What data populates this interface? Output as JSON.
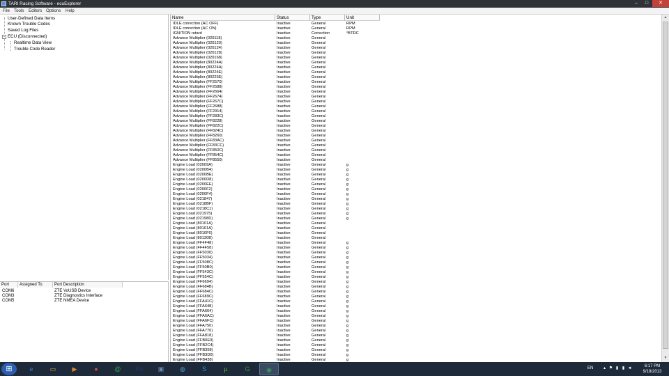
{
  "window": {
    "title": "TARI Racing Software - ecuExplorer",
    "min_glyph": "–",
    "max_glyph": "□",
    "close_glyph": "✕"
  },
  "menu": [
    "File",
    "Tools",
    "Editors",
    "Options",
    "Help"
  ],
  "tree": {
    "items": [
      "User-Defined Data Items",
      "Known Trouble Codes",
      "Saved Log Files",
      "ECU (Disconnected)",
      "Realtime Data View",
      "Trouble Code Reader"
    ],
    "expander": "−"
  },
  "ports": {
    "columns": [
      "Port",
      "Assigned To",
      "Port Description"
    ],
    "rows": [
      [
        "COM6",
        "",
        "ZTE VoUSB Device"
      ],
      [
        "COM3",
        "",
        "ZTE Diagnostics Interface"
      ],
      [
        "COM5",
        "",
        "ZTE NMEA Device"
      ]
    ]
  },
  "grid": {
    "columns": [
      "Name",
      "Status",
      "Type",
      "Unit"
    ],
    "rows": [
      [
        "IDLE correction (AC OFF)",
        "Inactive",
        "General",
        "RPM"
      ],
      [
        "IDLE correction (AC ON)",
        "Inactive",
        "General",
        "RPM"
      ],
      [
        "IGNITION retard",
        "Inactive",
        "Correction",
        "°BTDC"
      ],
      [
        "Advance Multiplier (020118)",
        "Inactive",
        "General",
        ""
      ],
      [
        "Advance Multiplier (020120)",
        "Inactive",
        "General",
        ""
      ],
      [
        "Advance Multiplier (020124)",
        "Inactive",
        "General",
        ""
      ],
      [
        "Advance Multiplier (020128)",
        "Inactive",
        "General",
        ""
      ],
      [
        "Advance Multiplier (020168)",
        "Inactive",
        "General",
        ""
      ],
      [
        "Advance Multiplier (80224A)",
        "Inactive",
        "General",
        ""
      ],
      [
        "Advance Multiplier (80224A)",
        "Inactive",
        "General",
        ""
      ],
      [
        "Advance Multiplier (80224E)",
        "Inactive",
        "General",
        ""
      ],
      [
        "Advance Multiplier (80225E)",
        "Inactive",
        "General",
        ""
      ],
      [
        "Advance Multiplier (FF2570)",
        "Inactive",
        "General",
        ""
      ],
      [
        "Advance Multiplier (FF2588)",
        "Inactive",
        "General",
        ""
      ],
      [
        "Advance Multiplier (FF2664)",
        "Inactive",
        "General",
        ""
      ],
      [
        "Advance Multiplier (FF2674)",
        "Inactive",
        "General",
        ""
      ],
      [
        "Advance Multiplier (FF267C)",
        "Inactive",
        "General",
        ""
      ],
      [
        "Advance Multiplier (FF2688)",
        "Inactive",
        "General",
        ""
      ],
      [
        "Advance Multiplier (FF2914)",
        "Inactive",
        "General",
        ""
      ],
      [
        "Advance Multiplier (FF283C)",
        "Inactive",
        "General",
        ""
      ],
      [
        "Advance Multiplier (FF8228)",
        "Inactive",
        "General",
        ""
      ],
      [
        "Advance Multiplier (FF822C)",
        "Inactive",
        "General",
        ""
      ],
      [
        "Advance Multiplier (FF824C)",
        "Inactive",
        "General",
        ""
      ],
      [
        "Advance Multiplier (FF8260)",
        "Inactive",
        "General",
        ""
      ],
      [
        "Advance Multiplier (FF83AC)",
        "Inactive",
        "General",
        ""
      ],
      [
        "Advance Multiplier (FF83CC)",
        "Inactive",
        "General",
        ""
      ],
      [
        "Advance Multiplier (FF850C)",
        "Inactive",
        "General",
        ""
      ],
      [
        "Advance Multiplier (FF854C)",
        "Inactive",
        "General",
        ""
      ],
      [
        "Advance Multiplier (FF8550)",
        "Inactive",
        "General",
        ""
      ],
      [
        "Engine Load (02009A)",
        "Inactive",
        "General",
        "g"
      ],
      [
        "Engine Load (0200B4)",
        "Inactive",
        "General",
        "g"
      ],
      [
        "Engine Load (0200BE)",
        "Inactive",
        "General",
        "g"
      ],
      [
        "Engine Load (0200D8)",
        "Inactive",
        "General",
        "g"
      ],
      [
        "Engine Load (0200EE)",
        "Inactive",
        "General",
        "g"
      ],
      [
        "Engine Load (0200F2)",
        "Inactive",
        "General",
        "g"
      ],
      [
        "Engine Load (0200F4)",
        "Inactive",
        "General",
        "g"
      ],
      [
        "Engine Load (021847)",
        "Inactive",
        "General",
        "g"
      ],
      [
        "Engine Load (0218BF)",
        "Inactive",
        "General",
        "g"
      ],
      [
        "Engine Load (0218C1)",
        "Inactive",
        "General",
        "g"
      ],
      [
        "Engine Load (021975)",
        "Inactive",
        "General",
        "g"
      ],
      [
        "Engine Load (02198D)",
        "Inactive",
        "General",
        "g"
      ],
      [
        "Engine Load (80101A)",
        "Inactive",
        "General",
        ""
      ],
      [
        "Engine Load (80101A)",
        "Inactive",
        "General",
        ""
      ],
      [
        "Engine Load (8010F6)",
        "Inactive",
        "General",
        ""
      ],
      [
        "Engine Load (80130B)",
        "Inactive",
        "General",
        ""
      ],
      [
        "Engine Load (FF4F48)",
        "Inactive",
        "General",
        "g"
      ],
      [
        "Engine Load (FF4F58)",
        "Inactive",
        "General",
        "g"
      ],
      [
        "Engine Load (FF5030)",
        "Inactive",
        "General",
        "g"
      ],
      [
        "Engine Load (FF5034)",
        "Inactive",
        "General",
        "g"
      ],
      [
        "Engine Load (FF508C)",
        "Inactive",
        "General",
        "g"
      ],
      [
        "Engine Load (FF50B0)",
        "Inactive",
        "General",
        "g"
      ],
      [
        "Engine Load (FF543C)",
        "Inactive",
        "General",
        "g"
      ],
      [
        "Engine Load (FF554C)",
        "Inactive",
        "General",
        "g"
      ],
      [
        "Engine Load (FF6694)",
        "Inactive",
        "General",
        "g"
      ],
      [
        "Engine Load (FF684B)",
        "Inactive",
        "General",
        "g"
      ],
      [
        "Engine Load (FF684C)",
        "Inactive",
        "General",
        "g"
      ],
      [
        "Engine Load (FF689C)",
        "Inactive",
        "General",
        "g"
      ],
      [
        "Engine Load (FFA41C)",
        "Inactive",
        "General",
        "g"
      ],
      [
        "Engine Load (FFA648)",
        "Inactive",
        "General",
        "g"
      ],
      [
        "Engine Load (FFA664)",
        "Inactive",
        "General",
        "g"
      ],
      [
        "Engine Load (FFA6AC)",
        "Inactive",
        "General",
        "g"
      ],
      [
        "Engine Load (FFA6FC)",
        "Inactive",
        "General",
        "g"
      ],
      [
        "Engine Load (FFA750)",
        "Inactive",
        "General",
        "g"
      ],
      [
        "Engine Load (FFA770)",
        "Inactive",
        "General",
        "g"
      ],
      [
        "Engine Load (FFA818)",
        "Inactive",
        "General",
        "g"
      ],
      [
        "Engine Load (FFB0E0)",
        "Inactive",
        "General",
        "g"
      ],
      [
        "Engine Load (FFB2C4)",
        "Inactive",
        "General",
        "g"
      ],
      [
        "Engine Load (FFB358)",
        "Inactive",
        "General",
        "g"
      ],
      [
        "Engine Load (FFB3D0)",
        "Inactive",
        "General",
        "g"
      ],
      [
        "Engine Load (FFB438)",
        "Inactive",
        "General",
        "g"
      ]
    ]
  },
  "scrollbar": {
    "up_glyph": "▲",
    "down_glyph": "▼"
  },
  "taskbar": {
    "start_glyph": "⊞",
    "apps": [
      {
        "name": "ie-icon",
        "glyph": "e",
        "color": "#2a7fd4"
      },
      {
        "name": "folder-icon",
        "glyph": "▭",
        "color": "#e0b040"
      },
      {
        "name": "media-player-icon",
        "glyph": "▶",
        "color": "#e08a2a"
      },
      {
        "name": "chrome-icon",
        "glyph": "●",
        "color": "#d84a3a"
      },
      {
        "name": "at-icon",
        "glyph": "@",
        "color": "#2aa84a"
      },
      {
        "name": "photoshop-icon",
        "glyph": "Ps",
        "color": "#1f3b6a"
      },
      {
        "name": "network-icon",
        "glyph": "▣",
        "color": "#6a8ab8"
      },
      {
        "name": "globe-icon",
        "glyph": "◍",
        "color": "#4aa0d0"
      },
      {
        "name": "skype-icon",
        "glyph": "S",
        "color": "#1aa0e0"
      },
      {
        "name": "utorrent-icon",
        "glyph": "µ",
        "color": "#5ab03a"
      },
      {
        "name": "app-g-icon",
        "glyph": "G",
        "color": "#3a8a3a"
      },
      {
        "name": "ecuexplorer-icon",
        "glyph": "◉",
        "color": "#3a9a5a"
      }
    ],
    "lang": "EN",
    "tray_icons": [
      {
        "name": "arrow-up-icon",
        "glyph": "▴"
      },
      {
        "name": "flag-icon",
        "glyph": "⚑"
      },
      {
        "name": "bars-icon",
        "glyph": "▮"
      },
      {
        "name": "signal-icon",
        "glyph": "▮"
      },
      {
        "name": "volume-icon",
        "glyph": "◄"
      }
    ],
    "time": "6:17 PM",
    "date": "9/18/2013"
  }
}
